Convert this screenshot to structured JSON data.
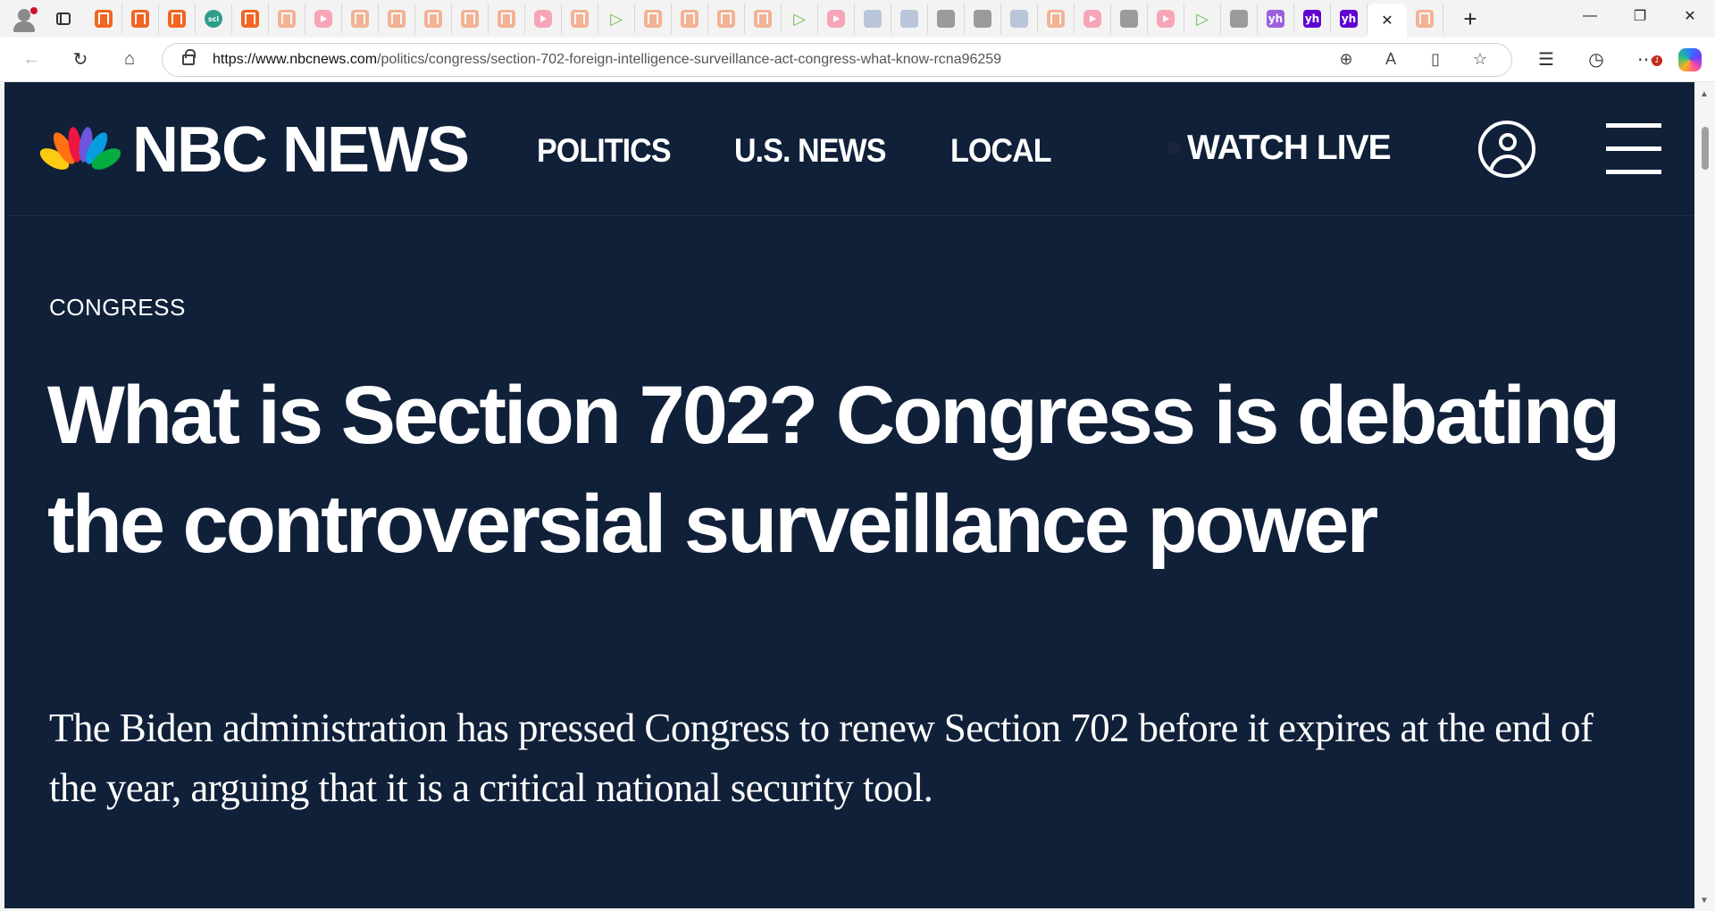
{
  "browser": {
    "active_tab_close": "✕",
    "new_tab": "+",
    "window": {
      "minimize": "—",
      "restore": "❐",
      "close": "✕"
    },
    "url_host": "https://www.nbcnews.com",
    "url_path": "/politics/congress/section-702-foreign-intelligence-surveillance-act-congress-what-know-rcna96259",
    "favicons": [
      "sci",
      "yh",
      "yh",
      "yh"
    ],
    "notification_count": "1"
  },
  "site": {
    "brand": "NBC NEWS",
    "nav": [
      "POLITICS",
      "U.S. NEWS",
      "LOCAL"
    ],
    "watch_live": "WATCH LIVE"
  },
  "article": {
    "eyebrow": "CONGRESS",
    "headline": "What is Section 702? Congress is debating the controversial surveillance power",
    "dek": "The Biden administration has pressed Congress to renew Section 702 before it expires at the end of the year, arguing that it is a critical national security tool."
  },
  "colors": {
    "page_bg": "#102039",
    "text": "#ffffff",
    "peacock": [
      "#fccc12",
      "#ff7112",
      "#ef1541",
      "#6e55dc",
      "#069de0",
      "#05ac3f"
    ]
  }
}
